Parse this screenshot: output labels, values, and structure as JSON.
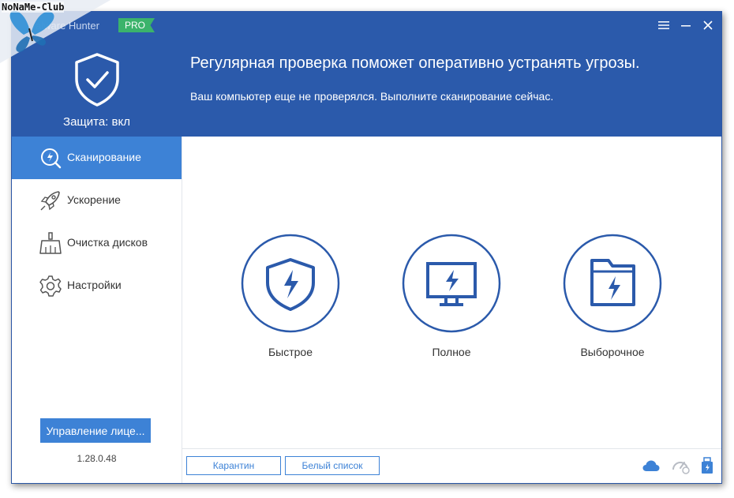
{
  "window": {
    "title": "alware Hunter",
    "badge": "PRO"
  },
  "header": {
    "protection_status": "Защита: вкл",
    "headline": "Регулярная проверка поможет оперативно устранять угрозы.",
    "subline": "Ваш компьютер еще не проверялся. Выполните сканирование сейчас."
  },
  "sidebar": {
    "items": [
      {
        "label": "Сканирование",
        "icon": "scan-icon",
        "active": true
      },
      {
        "label": "Ускорение",
        "icon": "rocket-icon",
        "active": false
      },
      {
        "label": "Очистка дисков",
        "icon": "broom-icon",
        "active": false
      },
      {
        "label": "Настройки",
        "icon": "gear-icon",
        "active": false
      }
    ],
    "license_button": "Управление лице...",
    "version": "1.28.0.48"
  },
  "scan_options": [
    {
      "label": "Быстрое",
      "icon": "shield-bolt-icon"
    },
    {
      "label": "Полное",
      "icon": "monitor-bolt-icon"
    },
    {
      "label": "Выборочное",
      "icon": "folder-bolt-icon"
    }
  ],
  "bottom": {
    "quarantine": "Карантин",
    "whitelist": "Белый список"
  },
  "watermark": {
    "text": "NoNaMe-Club"
  },
  "colors": {
    "header_bg": "#2b5aab",
    "accent": "#3d82d6",
    "badge_green": "#3bb36b",
    "icon_blue": "#2b5aab"
  }
}
